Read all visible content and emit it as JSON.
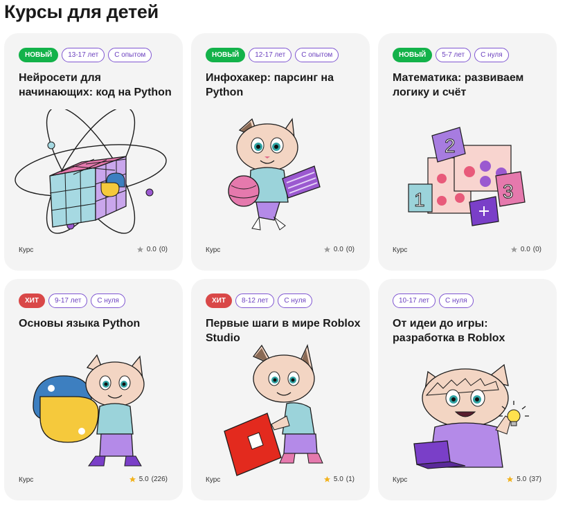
{
  "page": {
    "title": "Курсы для детей"
  },
  "colors": {
    "new_badge": "#13b24a",
    "hit_badge": "#d94848",
    "outline_tag": "#7f55d1",
    "card_bg": "#f4f4f4",
    "star_empty": "#9a9a9a",
    "star_filled": "#f2b21b"
  },
  "courses": [
    {
      "badge": "НОВЫЙ",
      "badge_kind": "new",
      "age": "13-17 лет",
      "level": "С опытом",
      "title": "Нейросети для начинающих: код на Python",
      "type": "Курс",
      "rating": "0.0",
      "reviews": "(0)",
      "star": "star-empty-icon",
      "illustration": "rubiks-cube-python-icon"
    },
    {
      "badge": "НОВЫЙ",
      "badge_kind": "new",
      "age": "12-17 лет",
      "level": "С опытом",
      "title": "Инфохакер: парсинг на Python",
      "type": "Курс",
      "rating": "0.0",
      "reviews": "(0)",
      "star": "star-empty-icon",
      "illustration": "cat-with-keyboard-icon"
    },
    {
      "badge": "НОВЫЙ",
      "badge_kind": "new",
      "age": "5-7 лет",
      "level": "С нуля",
      "title": "Математика: развиваем логику и счёт",
      "type": "Курс",
      "rating": "0.0",
      "reviews": "(0)",
      "star": "star-empty-icon",
      "illustration": "number-cards-icon"
    },
    {
      "badge": "ХИТ",
      "badge_kind": "hit",
      "age": "9-17 лет",
      "level": "С нуля",
      "title": "Основы языка Python",
      "type": "Курс",
      "rating": "5.0",
      "reviews": "(226)",
      "star": "star-filled-icon",
      "illustration": "cat-with-python-logo-icon"
    },
    {
      "badge": "ХИТ",
      "badge_kind": "hit",
      "age": "8-12 лет",
      "level": "С нуля",
      "title": "Первые шаги в мире Roblox Studio",
      "type": "Курс",
      "rating": "5.0",
      "reviews": "(1)",
      "star": "star-filled-icon",
      "illustration": "cat-with-roblox-logo-icon"
    },
    {
      "badge": "",
      "badge_kind": "none",
      "age": "10-17 лет",
      "level": "С нуля",
      "title": "От идеи до игры: разработка в Roblox",
      "type": "Курс",
      "rating": "5.0",
      "reviews": "(37)",
      "star": "star-filled-icon",
      "illustration": "cat-with-laptop-and-bulb-icon"
    }
  ]
}
